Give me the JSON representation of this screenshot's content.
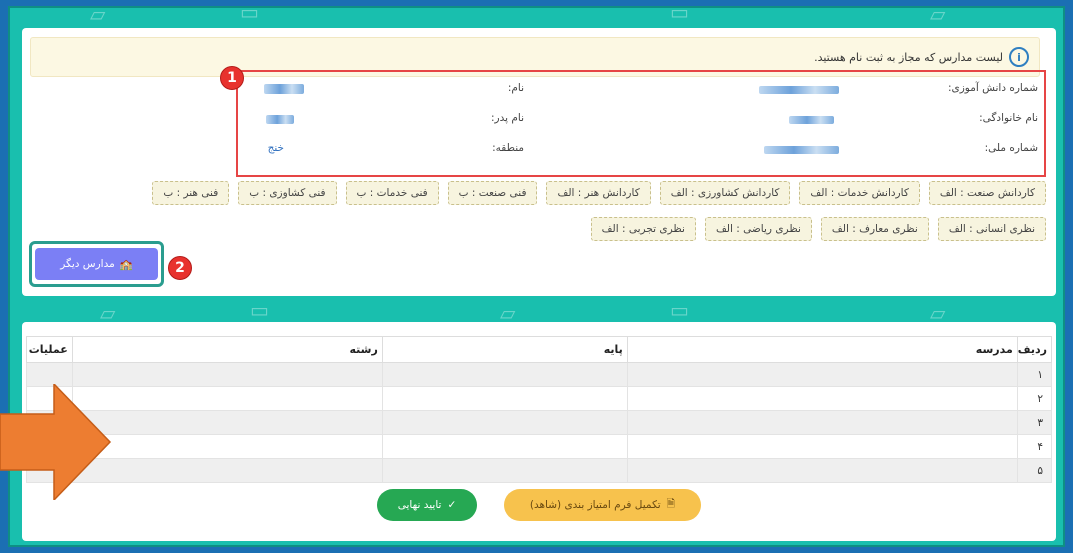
{
  "colors": {
    "accent": "#19bfae",
    "annotation_red": "#e8322e",
    "alert_bg": "#fcf8e3",
    "button_purple": "#7b7ff5",
    "button_yellow": "#f7c24d",
    "button_green": "#26a853",
    "arrow_orange": "#ed7d31"
  },
  "alert": {
    "icon": "info-icon",
    "text": "لیست مدارس که مجاز به ثبت نام هستید."
  },
  "annotations": {
    "one": "1",
    "two": "2"
  },
  "student": {
    "student_no_label": "شماره دانش آموزی:",
    "name_label": "نام:",
    "family_label": "نام خانوادگی:",
    "father_label": "نام پدر:",
    "national_id_label": "شماره ملی:",
    "region_label": "منطقه:",
    "region_value": "خنج"
  },
  "chips_row1": [
    "کاردانش صنعت : الف",
    "کاردانش خدمات : الف",
    "کاردانش کشاورزی : الف",
    "کاردانش هنر : الف",
    "فنی صنعت : ب",
    "فنی خدمات : ب",
    "فنی کشاوزی : ب",
    "فنی هنر : ب"
  ],
  "chips_row2": [
    "نظری انسانی : الف",
    "نظری معارف : الف",
    "نظری ریاضی : الف",
    "نظری تجربی : الف"
  ],
  "other_schools_button": {
    "label": "مدارس دیگر",
    "icon": "school-icon"
  },
  "table": {
    "headers": {
      "row": "ردیف",
      "school": "مدرسه",
      "grade": "پایه",
      "field": "رشته",
      "actions": "عملیات"
    },
    "rows": [
      "۱",
      "۲",
      "۳",
      "۴",
      "۵"
    ]
  },
  "buttons": {
    "complete_form": "تکمیل فرم امتیاز بندی (شاهد)",
    "final_confirm": "تایید نهایی"
  }
}
